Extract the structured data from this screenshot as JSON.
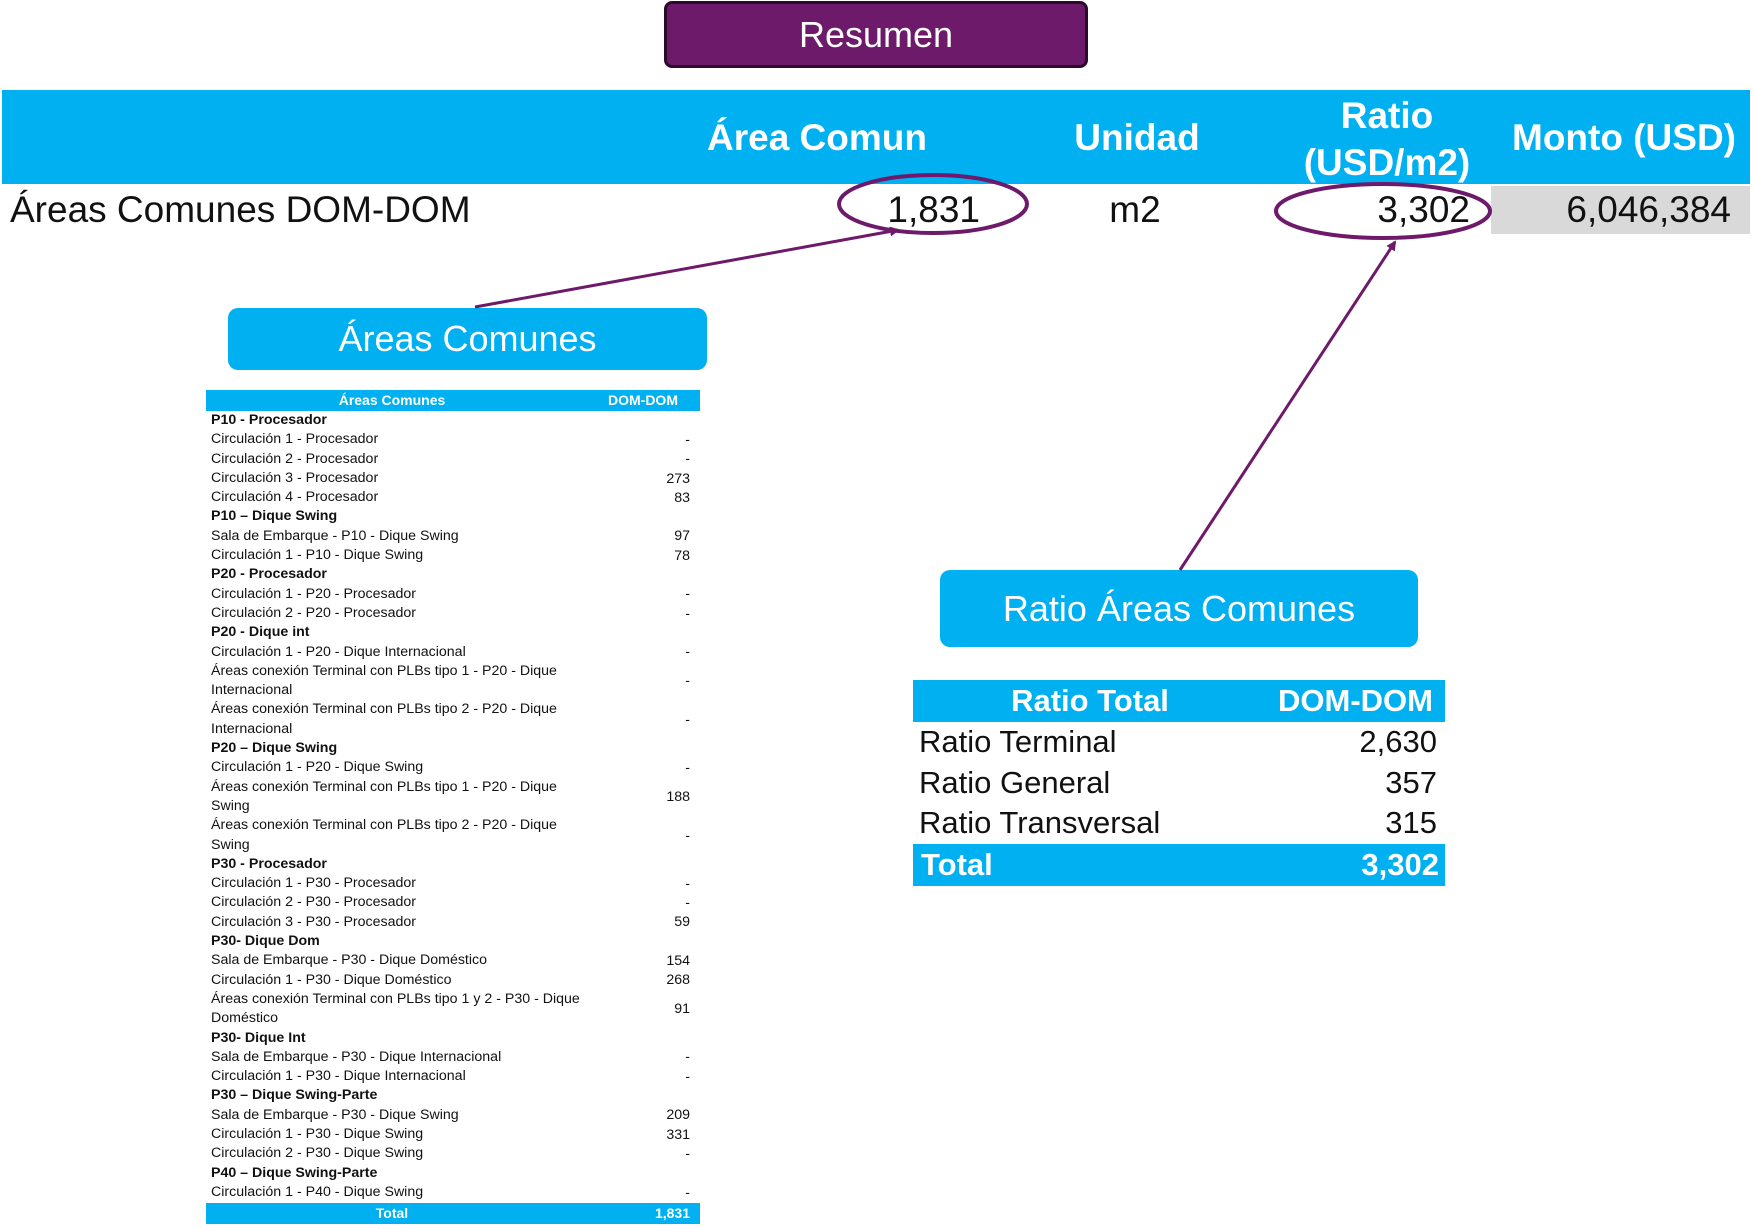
{
  "title": "Resumen",
  "summary": {
    "headers": {
      "area": "Área Comun",
      "unidad": "Unidad",
      "ratio_line1": "Ratio",
      "ratio_line2": "(USD/m2)",
      "monto": "Monto (USD)"
    },
    "row": {
      "label": "Áreas Comunes DOM-DOM",
      "area": "1,831",
      "unidad": "m2",
      "ratio": "3,302",
      "monto": "6,046,384"
    }
  },
  "labels": {
    "areas_box": "Áreas Comunes",
    "ratio_box": "Ratio Áreas Comunes"
  },
  "colors": {
    "header_blue": "#00b0f0",
    "purple": "#6e1a6a",
    "gray_cell": "#d9d9d9"
  },
  "areas_table": {
    "header": {
      "col1": "Áreas Comunes",
      "col2": "DOM-DOM"
    },
    "rows": [
      {
        "label": "P10 - Procesador",
        "value": "",
        "section": true
      },
      {
        "label": "Circulación 1 - Procesador",
        "value": "-"
      },
      {
        "label": "Circulación 2 - Procesador",
        "value": "-"
      },
      {
        "label": "Circulación 3 - Procesador",
        "value": "273"
      },
      {
        "label": "Circulación 4 - Procesador",
        "value": "83"
      },
      {
        "label": "P10 – Dique Swing",
        "value": "",
        "section": true
      },
      {
        "label": "Sala de Embarque - P10 - Dique Swing",
        "value": "97"
      },
      {
        "label": "Circulación 1 - P10 - Dique Swing",
        "value": "78"
      },
      {
        "label": "P20 - Procesador",
        "value": "",
        "section": true
      },
      {
        "label": "Circulación 1 - P20 - Procesador",
        "value": "-"
      },
      {
        "label": "Circulación 2 - P20 - Procesador",
        "value": "-"
      },
      {
        "label": "P20 - Dique int",
        "value": "",
        "section": true
      },
      {
        "label": "Circulación 1 - P20 - Dique Internacional",
        "value": "-"
      },
      {
        "label": "Áreas conexión Terminal con PLBs tipo 1 - P20 - Dique Internacional",
        "value": "-"
      },
      {
        "label": "Áreas conexión Terminal con PLBs tipo 2 - P20 - Dique Internacional",
        "value": "-"
      },
      {
        "label": "P20 – Dique Swing",
        "value": "",
        "section": true
      },
      {
        "label": "Circulación 1 - P20 - Dique Swing",
        "value": "-"
      },
      {
        "label": "Áreas conexión Terminal con PLBs tipo 1 - P20 - Dique Swing",
        "value": "188"
      },
      {
        "label": "Áreas conexión Terminal con PLBs tipo 2 - P20 - Dique Swing",
        "value": "-"
      },
      {
        "label": "P30 - Procesador",
        "value": "",
        "section": true
      },
      {
        "label": "Circulación 1 - P30 - Procesador",
        "value": "-"
      },
      {
        "label": "Circulación 2 - P30 - Procesador",
        "value": "-"
      },
      {
        "label": "Circulación 3 - P30 - Procesador",
        "value": "59"
      },
      {
        "label": "P30- Dique Dom",
        "value": "",
        "section": true
      },
      {
        "label": "Sala de Embarque - P30 - Dique Doméstico",
        "value": "154"
      },
      {
        "label": "Circulación 1 - P30 - Dique Doméstico",
        "value": "268"
      },
      {
        "label": "Áreas conexión Terminal con PLBs tipo 1 y 2 - P30 - Dique Doméstico",
        "value": "91"
      },
      {
        "label": "P30- Dique Int",
        "value": "",
        "section": true
      },
      {
        "label": "Sala de Embarque - P30 - Dique Internacional",
        "value": "-"
      },
      {
        "label": "Circulación 1 - P30 - Dique Internacional",
        "value": "-"
      },
      {
        "label": "P30 – Dique Swing-Parte",
        "value": "",
        "section": true
      },
      {
        "label": "Sala de Embarque - P30 - Dique Swing",
        "value": "209"
      },
      {
        "label": "Circulación 1 - P30 - Dique Swing",
        "value": "331"
      },
      {
        "label": "Circulación 2 - P30 - Dique Swing",
        "value": "-"
      },
      {
        "label": "P40 – Dique Swing-Parte",
        "value": "",
        "section": true
      },
      {
        "label": "Circulación 1 - P40 - Dique Swing",
        "value": "-"
      }
    ],
    "total": {
      "label": "Total",
      "value": "1,831"
    }
  },
  "ratio_table": {
    "header": {
      "col1": "Ratio Total",
      "col2": "DOM-DOM"
    },
    "rows": [
      {
        "label": "Ratio Terminal",
        "value": "2,630"
      },
      {
        "label": "Ratio General",
        "value": "357"
      },
      {
        "label": "Ratio Transversal",
        "value": "315"
      }
    ],
    "total": {
      "label": "Total",
      "value": "3,302"
    }
  }
}
